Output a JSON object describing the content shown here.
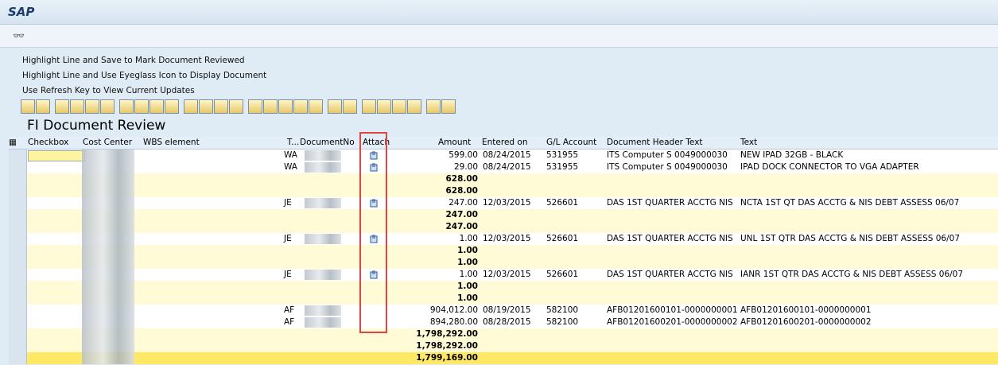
{
  "window": {
    "title": "SAP"
  },
  "toolbar": {
    "eyeglass_icon": "eyeglass-icon"
  },
  "hints": [
    "Highlight Line and Save to Mark Document Reviewed",
    "Highlight Line and Use Eyeglass Icon to Display Document",
    "Use Refresh Key to View Current Updates"
  ],
  "report": {
    "title": "FI Document Review"
  },
  "columns": {
    "checkbox": "Checkbox",
    "cost_center": "Cost Center",
    "wbs": "WBS element",
    "type": "T...",
    "docno": "DocumentNo",
    "attach": "Attach",
    "amount": "Amount",
    "entered": "Entered on",
    "gl": "G/L Account",
    "header_text": "Document Header Text",
    "text": "Text"
  },
  "rows": [
    {
      "kind": "item",
      "type": "WA",
      "amount": "599.00",
      "entered": "08/24/2015",
      "gl": "531955",
      "header": "ITS Computer S 0049000030",
      "text": "NEW IPAD 32GB - BLACK",
      "attach": true
    },
    {
      "kind": "item",
      "type": "WA",
      "amount": "29.00",
      "entered": "08/24/2015",
      "gl": "531955",
      "header": "ITS Computer S 0049000030",
      "text": "IPAD DOCK CONNECTOR TO VGA ADAPTER",
      "attach": true
    },
    {
      "kind": "sub",
      "amount": "628.00"
    },
    {
      "kind": "sub",
      "amount": "628.00"
    },
    {
      "kind": "item",
      "type": "JE",
      "amount": "247.00",
      "entered": "12/03/2015",
      "gl": "526601",
      "header": "DAS 1ST QUARTER ACCTG NIS",
      "text": "NCTA 1ST QT DAS ACCTG & NIS DEBT ASSESS 06/07",
      "attach": true
    },
    {
      "kind": "sub",
      "amount": "247.00"
    },
    {
      "kind": "sub",
      "amount": "247.00"
    },
    {
      "kind": "item",
      "type": "JE",
      "amount": "1.00",
      "entered": "12/03/2015",
      "gl": "526601",
      "header": "DAS 1ST QUARTER ACCTG NIS",
      "text": "UNL 1ST QTR DAS ACCTG & NIS DEBT ASSESS 06/07",
      "attach": true
    },
    {
      "kind": "sub",
      "amount": "1.00"
    },
    {
      "kind": "sub",
      "amount": "1.00"
    },
    {
      "kind": "item",
      "type": "JE",
      "amount": "1.00",
      "entered": "12/03/2015",
      "gl": "526601",
      "header": "DAS 1ST QUARTER ACCTG NIS",
      "text": "IANR 1ST QTR DAS ACCTG & NIS DEBT ASSESS 06/07",
      "attach": true
    },
    {
      "kind": "sub",
      "amount": "1.00"
    },
    {
      "kind": "sub",
      "amount": "1.00"
    },
    {
      "kind": "item",
      "type": "AF",
      "amount": "904,012.00",
      "entered": "08/19/2015",
      "gl": "582100",
      "header": "AFB01201600101-0000000001",
      "text": "AFB01201600101-0000000001",
      "attach": false
    },
    {
      "kind": "item",
      "type": "AF",
      "amount": "894,280.00",
      "entered": "08/28/2015",
      "gl": "582100",
      "header": "AFB01201600201-0000000002",
      "text": "AFB01201600201-0000000002",
      "attach": false
    },
    {
      "kind": "sub2",
      "amount": "1,798,292.00"
    },
    {
      "kind": "sub2",
      "amount": "1,798,292.00"
    },
    {
      "kind": "total",
      "amount": "1,799,169.00"
    }
  ],
  "colors": {
    "subtotal_bg": "#fffbd6",
    "total_bg": "#ffe866",
    "highlight_box": "#e04545"
  }
}
